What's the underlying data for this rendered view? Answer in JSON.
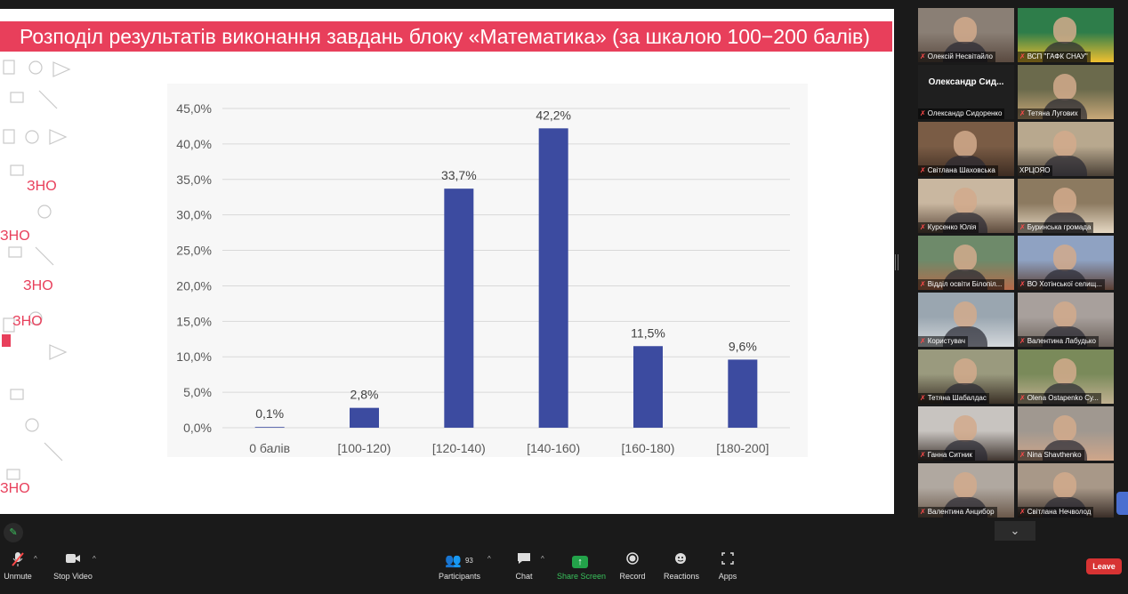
{
  "slide": {
    "title": "Розподіл результатів виконання завдань блоку «Математика» (за шкалою 100−200 балів)",
    "title_bg": "#e83f5b",
    "deco_text": [
      "ЗНО",
      "ЗНО",
      "ЗНО",
      "ЗНО",
      "ЗНО"
    ]
  },
  "chart_data": {
    "type": "bar",
    "categories": [
      "0 балів",
      "[100-120)",
      "[120-140)",
      "[140-160)",
      "[160-180)",
      "[180-200]"
    ],
    "values": [
      0.1,
      2.8,
      33.7,
      42.2,
      11.5,
      9.6
    ],
    "value_labels": [
      "0,1%",
      "2,8%",
      "33,7%",
      "42,2%",
      "11,5%",
      "9,6%"
    ],
    "yticks": [
      "0,0%",
      "5,0%",
      "10,0%",
      "15,0%",
      "20,0%",
      "25,0%",
      "30,0%",
      "35,0%",
      "40,0%",
      "45,0%"
    ],
    "ylim": [
      0,
      45
    ],
    "grid": true,
    "bar_color": "#3c4ba0",
    "title": "",
    "xlabel": "",
    "ylabel": ""
  },
  "participants": [
    {
      "name": "Олексій Несвітайло",
      "muted": true
    },
    {
      "name": "ВСП \"ГАФК СНАУ\"",
      "muted": true
    },
    {
      "name": "Олександр Сидоренко",
      "muted": true,
      "card": "Олександр  Сид..."
    },
    {
      "name": "Тетяна Лугових",
      "muted": true
    },
    {
      "name": "Світлана Шаховська",
      "muted": true
    },
    {
      "name": "ХРЦОЯО",
      "muted": false
    },
    {
      "name": "Курсенко Юлія",
      "muted": true
    },
    {
      "name": "Буринська громада",
      "muted": true
    },
    {
      "name": "Відділ освіти Білопіл...",
      "muted": true
    },
    {
      "name": "ВО Хотінської селищ...",
      "muted": true
    },
    {
      "name": "Користувач",
      "muted": true
    },
    {
      "name": "Валентина Лабудько",
      "muted": true
    },
    {
      "name": "Тетяна Шабалдас",
      "muted": true
    },
    {
      "name": "Olena Ostapenko Су...",
      "muted": true
    },
    {
      "name": "Ганна Ситник",
      "muted": true
    },
    {
      "name": "Nina Shavthenko",
      "muted": true
    },
    {
      "name": "Валентина Анцибор",
      "muted": true
    },
    {
      "name": "Світлана Нечволод",
      "muted": true
    }
  ],
  "toolbar": {
    "unmute": "Unmute",
    "stop_video": "Stop Video",
    "participants": "Participants",
    "participants_count": "93",
    "chat": "Chat",
    "share_screen": "Share Screen",
    "record": "Record",
    "reactions": "Reactions",
    "apps": "Apps",
    "leave": "Leave"
  },
  "colors": {
    "leave": "#d73333",
    "share": "#23a34a",
    "active_speaker": "#d7e14a"
  }
}
